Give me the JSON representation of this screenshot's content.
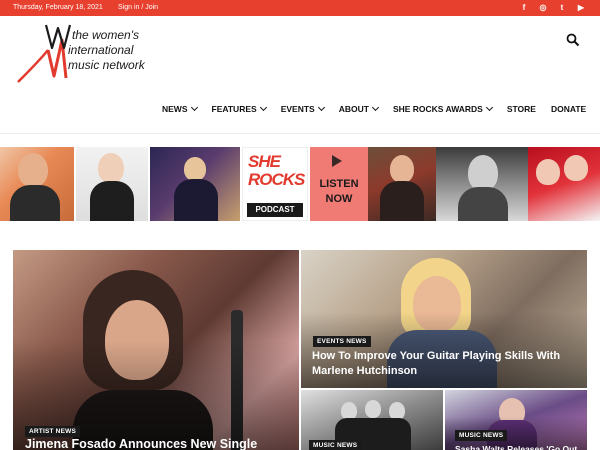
{
  "topbar": {
    "date": "Thursday, February 18, 2021",
    "signin": "Sign in / Join",
    "social": [
      "f",
      "◎",
      "t",
      "▶"
    ]
  },
  "logo": {
    "line1": "the women's",
    "line2": "international",
    "line3": "music network"
  },
  "nav": {
    "items": [
      {
        "label": "NEWS",
        "dropdown": true
      },
      {
        "label": "FEATURES",
        "dropdown": true
      },
      {
        "label": "EVENTS",
        "dropdown": true
      },
      {
        "label": "ABOUT",
        "dropdown": true
      },
      {
        "label": "SHE ROCKS AWARDS",
        "dropdown": true
      },
      {
        "label": "STORE",
        "dropdown": false
      },
      {
        "label": "DONATE",
        "dropdown": false
      }
    ]
  },
  "banner": {
    "she": "SHE",
    "rocks": "ROCKS",
    "podcast": "PODCAST",
    "listen_line1": "LISTEN",
    "listen_line2": "NOW"
  },
  "articles": {
    "main": {
      "category": "ARTIST NEWS",
      "title": "Jimena Fosado Announces New Single"
    },
    "top": {
      "category": "EVENTS NEWS",
      "title": "How To Improve Your Guitar Playing Skills With Marlene Hutchinson"
    },
    "bottom_left": {
      "category": "MUSIC NEWS"
    },
    "bottom_right": {
      "category": "MUSIC NEWS",
      "title": "Sasha Walts Releases 'Go Out"
    }
  },
  "colors": {
    "accent": "#e8402f",
    "dark": "#1a1a1a"
  }
}
